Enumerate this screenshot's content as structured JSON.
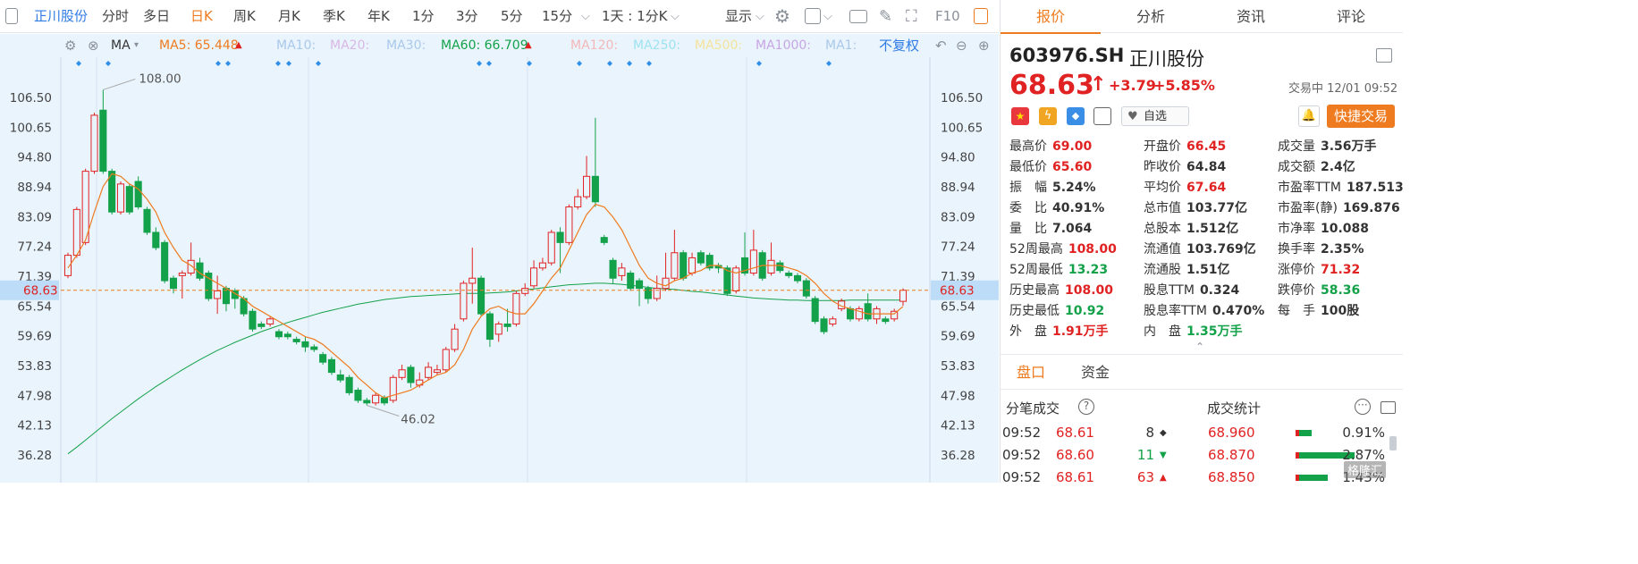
{
  "toolbar": {
    "stock_name": "正川股份",
    "periods": [
      "分时",
      "多日",
      "日K",
      "周K",
      "月K",
      "季K",
      "年K",
      "1分",
      "3分",
      "5分",
      "15分"
    ],
    "active_period": "日K",
    "range_label": "1天 : 1分K",
    "display_label": "显示",
    "f10_label": "F10"
  },
  "ma_bar": {
    "ma_label": "MA",
    "ma5": "MA5: 65.448",
    "ma10": "MA10:",
    "ma20": "MA20:",
    "ma30": "MA30:",
    "ma60": "MA60: 66.709",
    "ma120": "MA120:",
    "ma250": "MA250:",
    "ma500": "MA500:",
    "ma1000": "MA1000:",
    "ma1": "MA1:",
    "adjust_label": "不复权"
  },
  "colors": {
    "up": "#e02222",
    "down": "#13a14a",
    "accent": "#ee7b1f",
    "blue": "#2f7be5",
    "chart_bg": "#eaf4fd"
  },
  "chart_data": {
    "type": "candlestick",
    "y_ticks": [
      106.5,
      100.65,
      94.8,
      88.94,
      83.09,
      77.24,
      71.39,
      65.54,
      59.69,
      53.83,
      47.98,
      42.13,
      36.28
    ],
    "y_tick_labels": [
      "106.50",
      "100.65",
      "94.80",
      "88.94",
      "83.09",
      "77.24",
      "71.39",
      "65.54",
      "59.69",
      "53.83",
      "47.98",
      "42.13",
      "36.28"
    ],
    "ylim": [
      33.0,
      111.0
    ],
    "current_price_label": "68.63",
    "current_price": 68.63,
    "max_label": "108.00",
    "max_value": 108.0,
    "min_label": "46.02",
    "min_value": 46.02,
    "candles": [
      [
        71.5,
        75.5,
        71.0,
        76.0
      ],
      [
        75.5,
        84.5,
        75.0,
        85.0
      ],
      [
        78.0,
        92.0,
        77.5,
        92.5
      ],
      [
        92.0,
        103.0,
        91.5,
        103.5
      ],
      [
        104.0,
        92.0,
        91.5,
        108.0
      ],
      [
        92.0,
        84.0,
        83.5,
        92.5
      ],
      [
        84.0,
        89.5,
        83.5,
        90.0
      ],
      [
        89.0,
        84.0,
        83.5,
        89.5
      ],
      [
        90.0,
        85.0,
        84.5,
        91.0
      ],
      [
        84.5,
        80.0,
        79.5,
        85.0
      ],
      [
        80.0,
        77.0,
        76.5,
        81.0
      ],
      [
        78.0,
        70.5,
        70.0,
        78.5
      ],
      [
        71.0,
        69.0,
        68.0,
        71.5
      ],
      [
        71.5,
        72.0,
        67.0,
        72.5
      ],
      [
        72.0,
        74.5,
        71.5,
        78.0
      ],
      [
        74.0,
        71.0,
        70.5,
        75.0
      ],
      [
        72.0,
        67.0,
        66.5,
        72.5
      ],
      [
        67.0,
        68.5,
        64.0,
        71.5
      ],
      [
        69.0,
        66.0,
        64.5,
        69.5
      ],
      [
        68.5,
        67.0,
        65.0,
        69.0
      ],
      [
        67.0,
        64.0,
        63.5,
        67.5
      ],
      [
        64.5,
        61.0,
        60.5,
        65.0
      ],
      [
        62.0,
        61.5,
        61.0,
        62.5
      ],
      [
        62.0,
        63.0,
        61.5,
        63.5
      ],
      [
        60.5,
        59.5,
        59.0,
        61.0
      ],
      [
        60.0,
        59.5,
        59.0,
        60.5
      ],
      [
        59.0,
        58.5,
        58.0,
        59.5
      ],
      [
        58.5,
        57.5,
        56.5,
        59.5
      ],
      [
        57.5,
        57.0,
        56.5,
        58.0
      ],
      [
        56.0,
        54.5,
        54.0,
        56.5
      ],
      [
        55.0,
        52.5,
        52.0,
        55.5
      ],
      [
        52.0,
        51.0,
        50.5,
        53.0
      ],
      [
        51.5,
        48.5,
        48.0,
        52.0
      ],
      [
        49.0,
        47.0,
        46.5,
        49.5
      ],
      [
        47.0,
        46.5,
        46.0,
        47.5
      ],
      [
        46.5,
        48.0,
        46.0,
        48.5
      ],
      [
        47.5,
        46.5,
        46.02,
        48.0
      ],
      [
        47.0,
        51.5,
        46.5,
        52.0
      ],
      [
        51.5,
        53.0,
        51.0,
        54.0
      ],
      [
        53.5,
        50.5,
        49.5,
        54.0
      ],
      [
        50.0,
        51.0,
        49.5,
        52.5
      ],
      [
        51.5,
        53.5,
        51.0,
        54.5
      ],
      [
        52.5,
        53.0,
        52.0,
        54.0
      ],
      [
        53.0,
        57.0,
        52.5,
        57.5
      ],
      [
        57.0,
        61.0,
        56.5,
        62.0
      ],
      [
        63.0,
        70.0,
        62.5,
        70.5
      ],
      [
        70.0,
        71.0,
        66.0,
        77.0
      ],
      [
        71.0,
        64.0,
        63.5,
        71.5
      ],
      [
        64.0,
        59.0,
        57.5,
        64.5
      ],
      [
        60.0,
        62.0,
        58.5,
        62.5
      ],
      [
        62.0,
        61.5,
        60.5,
        65.0
      ],
      [
        62.0,
        68.0,
        61.5,
        68.5
      ],
      [
        68.0,
        69.0,
        67.5,
        70.0
      ],
      [
        69.5,
        73.0,
        69.0,
        74.5
      ],
      [
        73.0,
        74.0,
        72.5,
        75.0
      ],
      [
        74.0,
        80.0,
        73.5,
        80.5
      ],
      [
        80.0,
        78.0,
        72.0,
        81.0
      ],
      [
        78.0,
        85.0,
        77.5,
        85.5
      ],
      [
        85.0,
        87.0,
        84.5,
        88.5
      ],
      [
        87.0,
        91.0,
        86.5,
        95.0
      ],
      [
        91.0,
        86.0,
        85.0,
        102.5
      ],
      [
        79.0,
        78.0,
        77.5,
        79.5
      ],
      [
        74.5,
        71.0,
        70.0,
        75.0
      ],
      [
        71.5,
        73.0,
        70.5,
        74.0
      ],
      [
        72.0,
        69.0,
        68.5,
        72.5
      ],
      [
        70.5,
        69.0,
        65.5,
        71.0
      ],
      [
        69.0,
        67.0,
        66.0,
        69.5
      ],
      [
        67.0,
        69.0,
        66.5,
        71.5
      ],
      [
        69.0,
        71.0,
        68.5,
        76.0
      ],
      [
        71.0,
        76.0,
        70.5,
        80.5
      ],
      [
        76.0,
        71.0,
        70.5,
        76.5
      ],
      [
        72.0,
        75.0,
        71.5,
        76.0
      ],
      [
        76.0,
        74.0,
        73.5,
        76.5
      ],
      [
        75.5,
        73.0,
        72.5,
        76.0
      ],
      [
        73.5,
        73.0,
        72.0,
        74.0
      ],
      [
        73.0,
        68.0,
        67.5,
        73.5
      ],
      [
        68.5,
        73.0,
        68.0,
        73.5
      ],
      [
        75.0,
        72.0,
        71.5,
        80.0
      ],
      [
        72.0,
        76.5,
        71.5,
        80.5
      ],
      [
        76.0,
        71.0,
        70.5,
        76.5
      ],
      [
        72.0,
        74.5,
        71.5,
        78.0
      ],
      [
        74.0,
        72.5,
        72.0,
        74.5
      ],
      [
        72.0,
        71.5,
        71.0,
        72.5
      ],
      [
        71.5,
        70.5,
        70.0,
        72.0
      ],
      [
        70.5,
        67.5,
        67.0,
        71.0
      ],
      [
        67.0,
        62.5,
        62.0,
        67.5
      ],
      [
        63.0,
        60.5,
        60.0,
        63.5
      ],
      [
        62.0,
        63.0,
        61.5,
        63.5
      ],
      [
        65.0,
        66.5,
        64.5,
        67.0
      ],
      [
        65.0,
        63.0,
        62.5,
        65.5
      ],
      [
        63.0,
        65.0,
        62.5,
        65.5
      ],
      [
        66.0,
        63.0,
        62.5,
        68.0
      ],
      [
        63.0,
        65.0,
        62.0,
        65.5
      ],
      [
        63.0,
        62.5,
        62.0,
        63.5
      ],
      [
        63.0,
        64.5,
        62.5,
        65.0
      ],
      [
        66.45,
        68.63,
        65.6,
        69.0
      ]
    ],
    "ma5": [
      73.0,
      75.5,
      78.5,
      84.0,
      89.0,
      91.5,
      91.0,
      89.5,
      88.5,
      86.5,
      84.0,
      80.0,
      77.0,
      74.5,
      73.5,
      72.0,
      71.0,
      70.0,
      69.0,
      68.0,
      67.0,
      65.5,
      64.5,
      63.5,
      62.5,
      61.5,
      60.5,
      59.5,
      59.0,
      58.0,
      56.5,
      55.0,
      53.5,
      51.5,
      50.0,
      48.5,
      47.5,
      48.0,
      48.5,
      49.0,
      50.0,
      51.0,
      52.0,
      52.5,
      54.0,
      57.0,
      61.0,
      63.5,
      65.0,
      65.5,
      64.5,
      64.0,
      64.0,
      66.0,
      68.5,
      71.0,
      73.0,
      76.5,
      80.0,
      83.5,
      85.5,
      85.0,
      83.0,
      80.5,
      77.0,
      73.5,
      71.0,
      70.0,
      69.5,
      70.5,
      71.0,
      72.0,
      72.5,
      73.5,
      73.5,
      72.5,
      72.0,
      72.5,
      73.0,
      73.5,
      73.5,
      73.5,
      73.0,
      72.5,
      71.5,
      70.0,
      68.0,
      66.5,
      65.5,
      65.0,
      64.5,
      64.0,
      64.0,
      64.0,
      64.0,
      65.45
    ],
    "ma60": [
      36.5,
      37.8,
      39.2,
      40.6,
      42.0,
      43.4,
      44.7,
      46.0,
      47.3,
      48.5,
      49.7,
      50.8,
      51.9,
      53.0,
      54.0,
      55.0,
      55.9,
      56.8,
      57.6,
      58.4,
      59.1,
      59.8,
      60.5,
      61.1,
      61.7,
      62.3,
      62.8,
      63.3,
      63.8,
      64.3,
      64.7,
      65.1,
      65.5,
      65.9,
      66.2,
      66.5,
      66.8,
      67.0,
      67.2,
      67.4,
      67.5,
      67.6,
      67.7,
      67.8,
      67.9,
      68.0,
      68.0,
      68.0,
      68.1,
      68.2,
      68.3,
      68.5,
      68.7,
      68.9,
      69.1,
      69.3,
      69.5,
      69.7,
      69.8,
      69.9,
      70.0,
      70.0,
      69.9,
      69.8,
      69.6,
      69.4,
      69.2,
      69.0,
      68.9,
      68.8,
      68.6,
      68.4,
      68.3,
      68.1,
      67.9,
      67.7,
      67.5,
      67.3,
      67.1,
      67.0,
      66.9,
      66.8,
      66.7,
      66.7,
      66.6,
      66.6,
      66.6,
      66.6,
      66.6,
      66.7,
      66.7,
      66.7,
      66.7,
      66.7,
      66.7,
      66.709
    ]
  },
  "panel": {
    "tabs": [
      "报价",
      "分析",
      "资讯",
      "评论"
    ],
    "active_tab": "报价",
    "code": "603976.SH",
    "name": "正川股份",
    "price": "68.63",
    "change": "+3.79",
    "change_pct": "+5.85%",
    "status_time": "交易中 12/01 09:52",
    "watch_label": "自选",
    "quick_trade_label": "快捷交易",
    "stats": [
      [
        {
          "k": "最高价",
          "v": "69.00",
          "c": "red"
        },
        {
          "k": "开盘价",
          "v": "66.45",
          "c": "red"
        },
        {
          "k": "成交量",
          "v": "3.56万手",
          "c": ""
        }
      ],
      [
        {
          "k": "最低价",
          "v": "65.60",
          "c": "red"
        },
        {
          "k": "昨收价",
          "v": "64.84",
          "c": ""
        },
        {
          "k": "成交额",
          "v": "2.4亿",
          "c": ""
        }
      ],
      [
        {
          "k": "振　幅",
          "v": "5.24%",
          "c": ""
        },
        {
          "k": "平均价",
          "v": "67.64",
          "c": "red"
        },
        {
          "k": "市盈率TTM",
          "v": "187.513",
          "c": ""
        }
      ],
      [
        {
          "k": "委　比",
          "v": "40.91%",
          "c": ""
        },
        {
          "k": "总市值",
          "v": "103.77亿",
          "c": ""
        },
        {
          "k": "市盈率(静)",
          "v": "169.876",
          "c": ""
        }
      ],
      [
        {
          "k": "量　比",
          "v": "7.064",
          "c": ""
        },
        {
          "k": "总股本",
          "v": "1.512亿",
          "c": ""
        },
        {
          "k": "市净率",
          "v": "10.088",
          "c": ""
        }
      ],
      [
        {
          "k": "52周最高",
          "v": "108.00",
          "c": "red"
        },
        {
          "k": "流通值",
          "v": "103.769亿",
          "c": ""
        },
        {
          "k": "换手率",
          "v": "2.35%",
          "c": ""
        }
      ],
      [
        {
          "k": "52周最低",
          "v": "13.23",
          "c": "green"
        },
        {
          "k": "流通股",
          "v": "1.51亿",
          "c": ""
        },
        {
          "k": "涨停价",
          "v": "71.32",
          "c": "red"
        }
      ],
      [
        {
          "k": "历史最高",
          "v": "108.00",
          "c": "red"
        },
        {
          "k": "股息TTM",
          "v": "0.324",
          "c": ""
        },
        {
          "k": "跌停价",
          "v": "58.36",
          "c": "green"
        }
      ],
      [
        {
          "k": "历史最低",
          "v": "10.92",
          "c": "green"
        },
        {
          "k": "股息率TTM",
          "v": "0.470%",
          "c": ""
        },
        {
          "k": "每　手",
          "v": "100股",
          "c": ""
        }
      ],
      [
        {
          "k": "外　盘",
          "v": "1.91万手",
          "c": "red"
        },
        {
          "k": "内　盘",
          "v": "1.35万手",
          "c": "green"
        },
        {
          "k": "",
          "v": "",
          "c": ""
        }
      ]
    ],
    "sub_tabs": [
      "盘口",
      "资金"
    ],
    "ticks_title": "分笔成交",
    "stats_title": "成交统计",
    "ticks": [
      {
        "time": "09:52",
        "price": "68.61",
        "vol": "8",
        "dir": "flat",
        "stat_price": "68.960",
        "pct": "0.91%",
        "bar_frac": 0.2
      },
      {
        "time": "09:52",
        "price": "68.60",
        "vol": "11",
        "dir": "down",
        "stat_price": "68.870",
        "pct": "2.87%",
        "bar_frac": 1.0
      },
      {
        "time": "09:52",
        "price": "68.61",
        "vol": "63",
        "dir": "up",
        "stat_price": "68.850",
        "pct": "1.43%",
        "bar_frac": 0.5
      }
    ],
    "watermark": "格隆汇"
  }
}
